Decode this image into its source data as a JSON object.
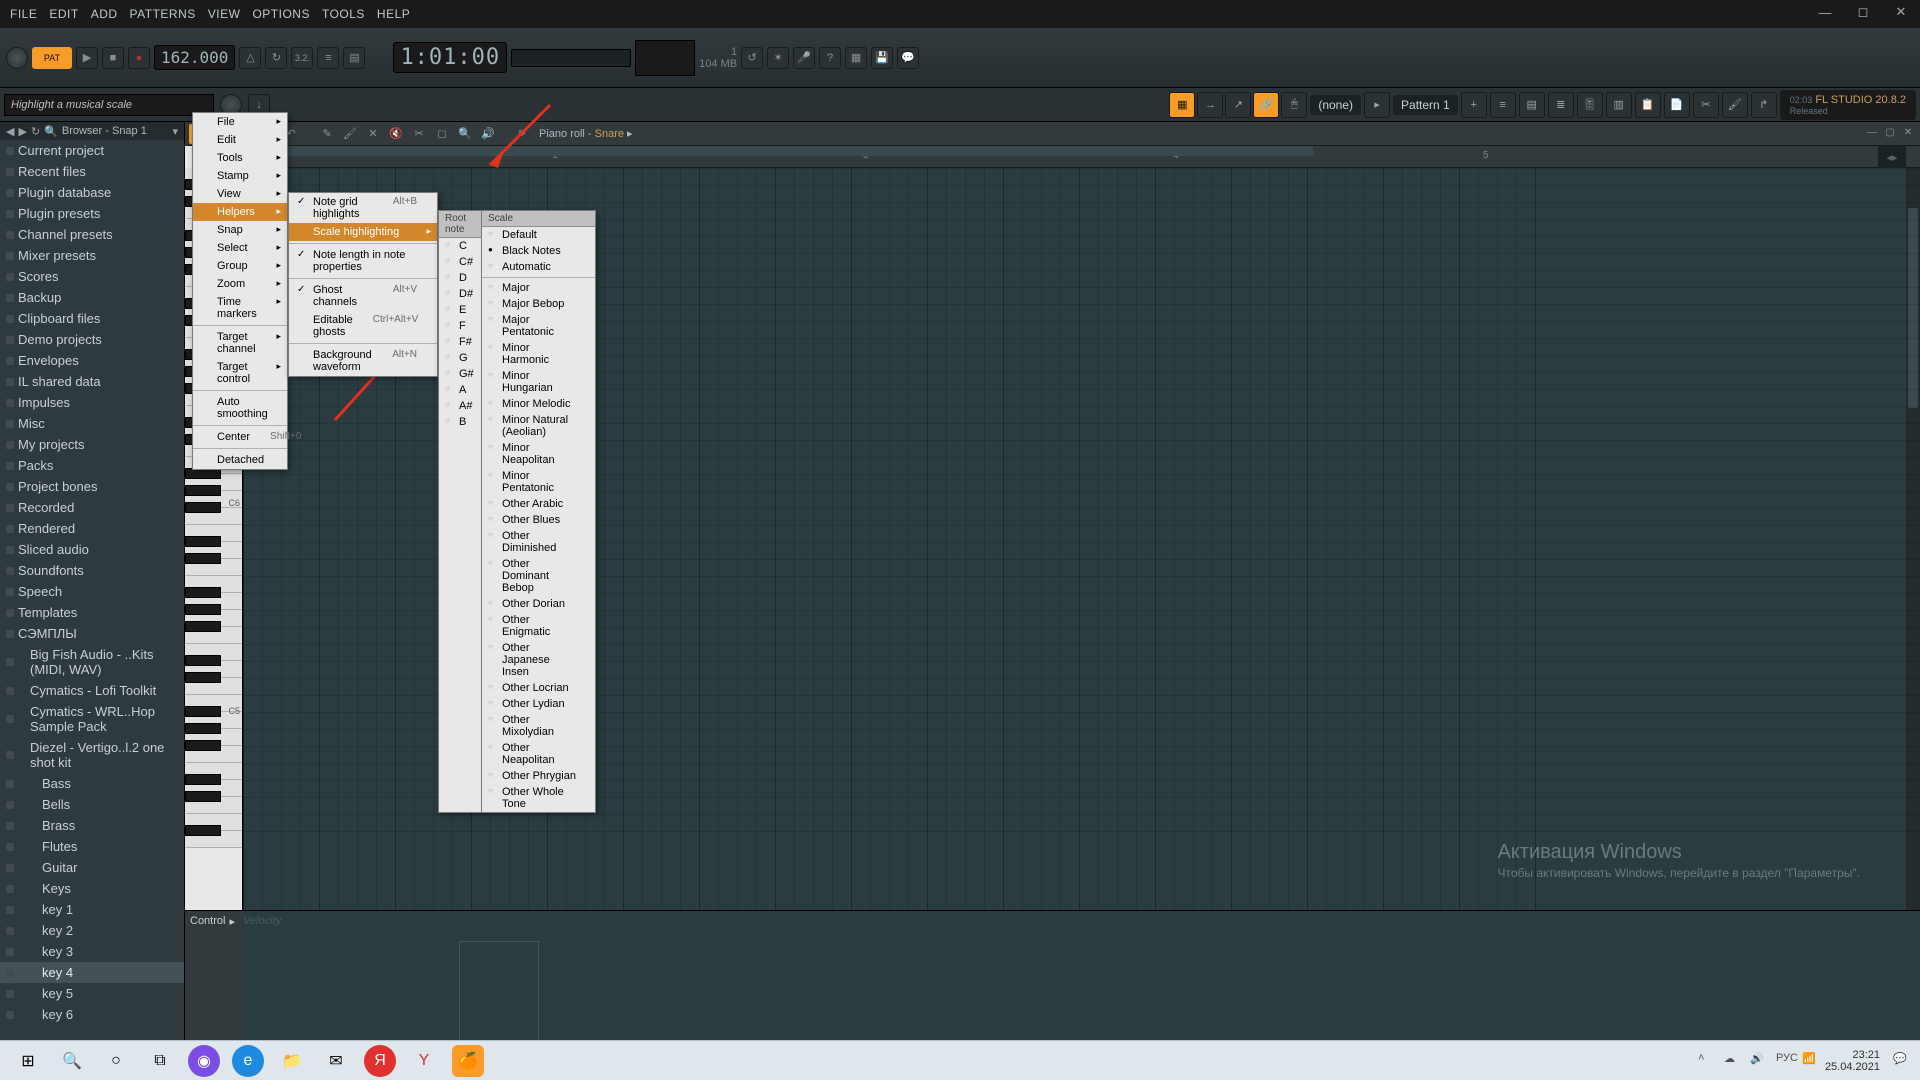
{
  "menubar": [
    "FILE",
    "EDIT",
    "ADD",
    "PATTERNS",
    "VIEW",
    "OPTIONS",
    "TOOLS",
    "HELP"
  ],
  "time": "1:01:00",
  "tempo": "162.000",
  "cpu": "1",
  "mem": "104 MB",
  "hint": "Highlight a musical scale",
  "pattern": "Pattern 1",
  "pattern_snap": "(none)",
  "version": {
    "code": "02:03",
    "name": "FL STUDIO 20.8.2",
    "state": "Released"
  },
  "browser": {
    "title": "Browser - Snap 1",
    "items": [
      {
        "label": "Current project",
        "type": "folder",
        "cls": ""
      },
      {
        "label": "Recent files",
        "type": "folder",
        "cls": ""
      },
      {
        "label": "Plugin database",
        "type": "folder",
        "cls": ""
      },
      {
        "label": "Plugin presets",
        "type": "folder",
        "cls": ""
      },
      {
        "label": "Channel presets",
        "type": "folder",
        "cls": ""
      },
      {
        "label": "Mixer presets",
        "type": "folder",
        "cls": ""
      },
      {
        "label": "Scores",
        "type": "folder",
        "cls": ""
      },
      {
        "label": "Backup",
        "type": "folder",
        "cls": ""
      },
      {
        "label": "Clipboard files",
        "type": "folder",
        "cls": ""
      },
      {
        "label": "Demo projects",
        "type": "folder",
        "cls": ""
      },
      {
        "label": "Envelopes",
        "type": "folder",
        "cls": ""
      },
      {
        "label": "IL shared data",
        "type": "folder",
        "cls": ""
      },
      {
        "label": "Impulses",
        "type": "folder",
        "cls": ""
      },
      {
        "label": "Misc",
        "type": "folder",
        "cls": ""
      },
      {
        "label": "My projects",
        "type": "folder",
        "cls": ""
      },
      {
        "label": "Packs",
        "type": "folder",
        "cls": ""
      },
      {
        "label": "Project bones",
        "type": "folder",
        "cls": ""
      },
      {
        "label": "Recorded",
        "type": "folder",
        "cls": ""
      },
      {
        "label": "Rendered",
        "type": "folder",
        "cls": ""
      },
      {
        "label": "Sliced audio",
        "type": "folder",
        "cls": ""
      },
      {
        "label": "Soundfonts",
        "type": "folder",
        "cls": ""
      },
      {
        "label": "Speech",
        "type": "folder",
        "cls": ""
      },
      {
        "label": "Templates",
        "type": "folder",
        "cls": ""
      },
      {
        "label": "СЭМПЛЫ",
        "type": "folder",
        "cls": ""
      },
      {
        "label": "Big Fish Audio - ..Kits (MIDI, WAV)",
        "type": "folder",
        "cls": "level1"
      },
      {
        "label": "Cymatics - Lofi Toolkit",
        "type": "folder",
        "cls": "level1"
      },
      {
        "label": "Cymatics - WRL..Hop Sample Pack",
        "type": "folder",
        "cls": "level1"
      },
      {
        "label": "Diezel - Vertigo..l.2 one shot kit",
        "type": "folder",
        "cls": "level1"
      },
      {
        "label": "Bass",
        "type": "folder",
        "cls": "level2"
      },
      {
        "label": "Bells",
        "type": "folder",
        "cls": "level2"
      },
      {
        "label": "Brass",
        "type": "folder",
        "cls": "level2"
      },
      {
        "label": "Flutes",
        "type": "folder",
        "cls": "level2"
      },
      {
        "label": "Guitar",
        "type": "folder",
        "cls": "level2"
      },
      {
        "label": "Keys",
        "type": "folder",
        "cls": "level2"
      },
      {
        "label": "key 1",
        "type": "file",
        "cls": "level2"
      },
      {
        "label": "key 2",
        "type": "file",
        "cls": "level2"
      },
      {
        "label": "key 3",
        "type": "file",
        "cls": "level2"
      },
      {
        "label": "key 4",
        "type": "file",
        "cls": "level2 sel"
      },
      {
        "label": "key 5",
        "type": "file",
        "cls": "level2"
      },
      {
        "label": "key 6",
        "type": "file",
        "cls": "level2"
      }
    ]
  },
  "pianoroll": {
    "title_prefix": "Piano roll - ",
    "channel": "Snare",
    "control": "Control",
    "velocity": "Velocity"
  },
  "ruler": [
    "2",
    "3",
    "4",
    "5"
  ],
  "keylabels": {
    "c6": "C6",
    "c5": "C5"
  },
  "main_menu": [
    {
      "label": "File",
      "sub": true
    },
    {
      "label": "Edit",
      "sub": true
    },
    {
      "label": "Tools",
      "sub": true
    },
    {
      "label": "Stamp",
      "sub": true
    },
    {
      "label": "View",
      "sub": true
    },
    {
      "label": "Helpers",
      "sub": true,
      "hl": true
    },
    {
      "label": "Snap",
      "sub": true
    },
    {
      "label": "Select",
      "sub": true
    },
    {
      "label": "Group",
      "sub": true
    },
    {
      "label": "Zoom",
      "sub": true
    },
    {
      "label": "Time markers",
      "sub": true
    },
    {
      "sep": true
    },
    {
      "label": "Target channel",
      "sub": true
    },
    {
      "label": "Target control",
      "sub": true
    },
    {
      "sep": true
    },
    {
      "label": "Auto smoothing"
    },
    {
      "sep": true
    },
    {
      "label": "Center",
      "shortcut": "Shift+0"
    },
    {
      "sep": true
    },
    {
      "label": "Detached"
    }
  ],
  "helpers_menu": [
    {
      "label": "Note grid highlights",
      "shortcut": "Alt+B",
      "check": true
    },
    {
      "label": "Scale highlighting",
      "sub": true,
      "hl": true
    },
    {
      "sep": true
    },
    {
      "label": "Note length in note properties",
      "check": true
    },
    {
      "sep": true
    },
    {
      "label": "Ghost channels",
      "shortcut": "Alt+V",
      "check": true
    },
    {
      "label": "Editable ghosts",
      "shortcut": "Ctrl+Alt+V"
    },
    {
      "sep": true
    },
    {
      "label": "Background waveform",
      "shortcut": "Alt+N"
    }
  ],
  "scale_menu": {
    "root_header": "Root note",
    "scale_header": "Scale",
    "roots": [
      "C",
      "C#",
      "D",
      "D#",
      "E",
      "F",
      "F#",
      "G",
      "G#",
      "A",
      "A#",
      "B"
    ],
    "scales": [
      {
        "label": "Default"
      },
      {
        "label": "Black Notes",
        "sel": true
      },
      {
        "label": "Automatic"
      },
      {
        "sep": true
      },
      {
        "label": "Major"
      },
      {
        "label": "Major Bebop"
      },
      {
        "label": "Major Pentatonic"
      },
      {
        "label": "Minor Harmonic"
      },
      {
        "label": "Minor Hungarian"
      },
      {
        "label": "Minor Melodic"
      },
      {
        "label": "Minor Natural (Aeolian)"
      },
      {
        "label": "Minor Neapolitan"
      },
      {
        "label": "Minor Pentatonic"
      },
      {
        "label": "Other Arabic"
      },
      {
        "label": "Other Blues"
      },
      {
        "label": "Other Diminished"
      },
      {
        "label": "Other Dominant Bebop"
      },
      {
        "label": "Other Dorian"
      },
      {
        "label": "Other Enigmatic"
      },
      {
        "label": "Other Japanese Insen"
      },
      {
        "label": "Other Locrian"
      },
      {
        "label": "Other Lydian"
      },
      {
        "label": "Other Mixolydian"
      },
      {
        "label": "Other Neapolitan"
      },
      {
        "label": "Other Phrygian"
      },
      {
        "label": "Other Whole Tone"
      }
    ]
  },
  "watermark": {
    "line1": "Активация Windows",
    "line2": "Чтобы активировать Windows, перейдите в раздел \"Параметры\"."
  },
  "taskbar": {
    "time": "23:21",
    "date": "25.04.2021",
    "lang": "РУС"
  },
  "tray_icons": [
    "chevron-up",
    "onedrive",
    "volume",
    "network",
    "battery"
  ]
}
